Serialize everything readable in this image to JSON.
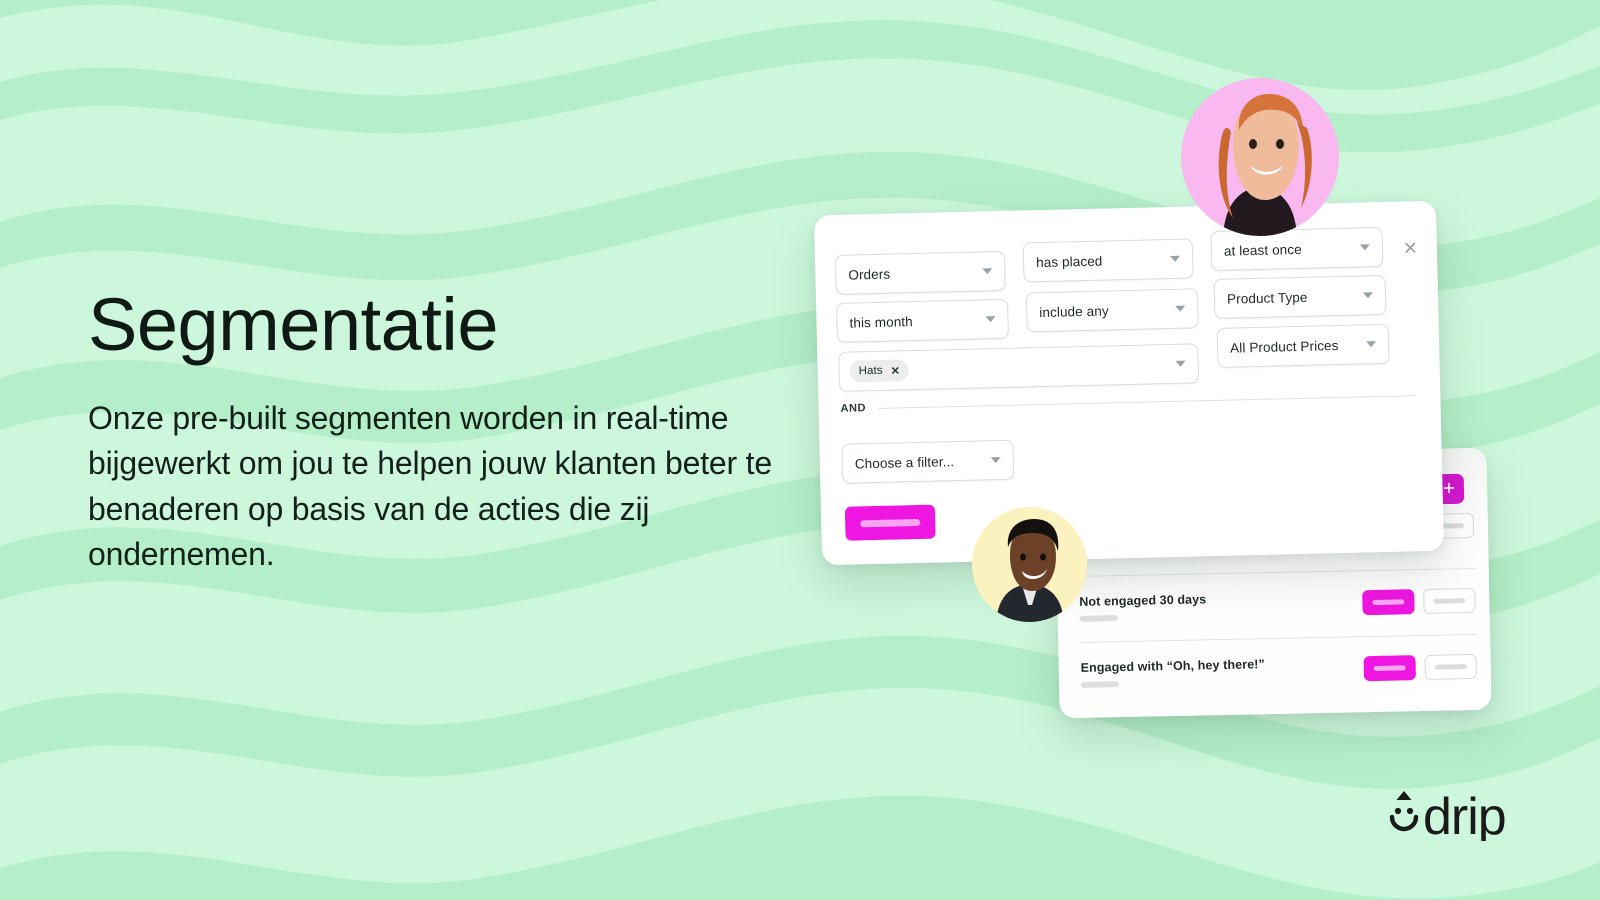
{
  "theme": {
    "bg_light": "#ccf7dc",
    "bg_wave": "#b4efc9",
    "accent_magenta": "#ee16e0",
    "accent_magenta_dark": "#d416cf",
    "text_dark": "#14211a",
    "avatar_pink": "#f9b8f0",
    "avatar_cream": "#fcf2c0"
  },
  "copy": {
    "headline": "Segmentatie",
    "body": "Onze pre-built segmenten worden in real-time bijgewerkt om jou te helpen jouw klanten beter te benaderen op basis van de acties die zij ondernemen."
  },
  "filter_card": {
    "fields": [
      {
        "name": "orders",
        "value": "Orders"
      },
      {
        "name": "has-placed",
        "value": "has placed"
      },
      {
        "name": "at-least-once",
        "value": "at least once"
      },
      {
        "name": "this-month",
        "value": "this month"
      },
      {
        "name": "include-any",
        "value": "include any"
      },
      {
        "name": "product-type",
        "value": "Product Type"
      },
      {
        "name": "all-product-prices",
        "value": "All Product Prices"
      },
      {
        "name": "choose-a-filter",
        "value": "Choose a filter..."
      }
    ],
    "tag": {
      "label": "Hats",
      "remove": "✕"
    },
    "and_label": "AND",
    "close_icon": "✕",
    "caret_icon": "chevron-down-icon"
  },
  "segment_list_card": {
    "add_button_icon": "+",
    "rows": [
      {
        "title": ""
      },
      {
        "title": "Not engaged 30 days"
      },
      {
        "title": "Engaged with “Oh, hey there!”"
      }
    ]
  },
  "avatars": [
    {
      "name": "woman-red-hair",
      "bg": "#f9b8f0"
    },
    {
      "name": "man-dark-blazer",
      "bg": "#fcf2c0"
    }
  ],
  "logo": {
    "wordmark": "drip",
    "mark": "drip-droplet-smiley-icon"
  }
}
